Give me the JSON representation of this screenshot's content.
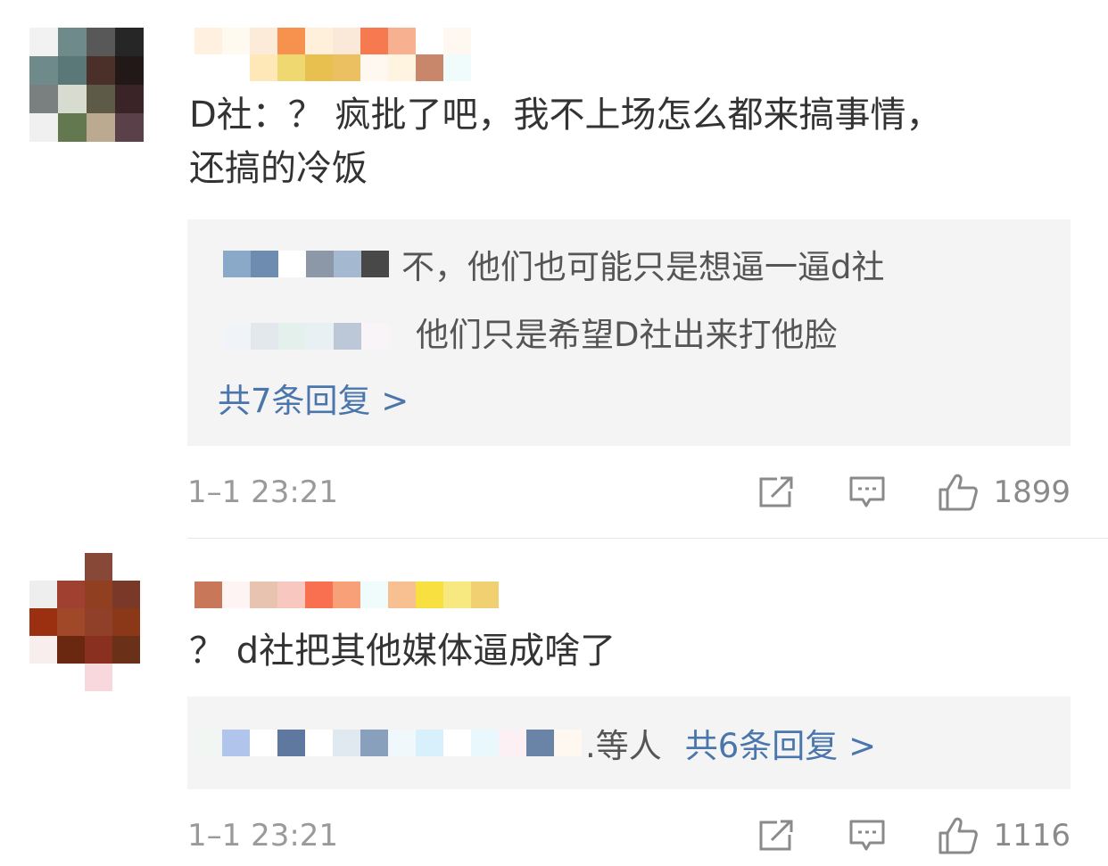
{
  "comments": [
    {
      "text_line1": "D社：？ 疯批了吧，我不上场怎么都来搞事情，",
      "text_line2": "还搞的冷饭",
      "replies": [
        {
          "text": "不，他们也可能只是想逼一逼d社"
        },
        {
          "text": "他们只是希望D社出来打他脸"
        }
      ],
      "more_replies": "共7条回复 >",
      "time": "1–1 23:21",
      "likes": "1899",
      "avatar_colors": [
        "#f2f2f2",
        "#6e8a8a",
        "#585858",
        "#262626",
        "#6e8a8a",
        "#5a7878",
        "#4a3028",
        "#221818",
        "#7a7f80",
        "#d8dcd0",
        "#5e5a48",
        "#3a2428",
        "#f0f0f0",
        "#647850",
        "#bcaa90",
        "#5a4048"
      ],
      "nick_colors": [
        "#fff0e0",
        "#fffaf0",
        "#fcebd8",
        "#f7924e",
        "#fff0dc",
        "#fae8d8",
        "#f77950",
        "#f7b090",
        "#ffffff",
        "#fff8f0",
        "#ffffff",
        "#ffffff",
        "#ffe8b8",
        "#f0d870",
        "#e8c050",
        "#eac060"
      ],
      "nick_colors2": [
        "#fff8f0",
        "#fff4e0",
        "#c8866a",
        "#f0fcfc",
        "#eba070",
        "#fff8f8",
        "#ffffff",
        "#ea9870",
        "#fff7e0",
        "#f0c000",
        "#ffc000",
        "#ffaa00"
      ]
    },
    {
      "text_line1": "？ d社把其他媒体逼成啥了",
      "replies_summary": ".等人",
      "more_replies": "共6条回复 >",
      "time": "1–1 23:21",
      "likes": "1116",
      "avatar_colors": [
        "#ffffff",
        "#ffffff",
        "#884838",
        "#ffffff",
        "#eeeeee",
        "#a04030",
        "#904020",
        "#7a3828",
        "#9a3010",
        "#a04828",
        "#904028",
        "#8a3818",
        "#f8eeee",
        "#6a2810",
        "#8a3020",
        "#6a3018",
        "#ffffff",
        "#ffffff",
        "#f8d8dc",
        "#ffffff"
      ],
      "nick_colors": [
        "#c87858",
        "#fff4f4",
        "#e8c4b0",
        "#f8c8c0",
        "#f87050",
        "#f8a078",
        "#f0fcfc",
        "#f8c090",
        "#f8e040",
        "#f8e880",
        "#f0d070",
        "#ffffff"
      ]
    }
  ],
  "reply_blur_1": [
    "#8aa8c8",
    "#6e8cb0",
    "#ffffff",
    "#8c98a8",
    "#a4b8d0",
    "#484848"
  ],
  "reply_blur_2": [
    "#f0f4f8",
    "#e2e8ec",
    "#e4f0ec",
    "#e8f0f4",
    "#bcc8d8",
    "#f8f4f8"
  ],
  "reply_blur_3": [
    "#f2f6f2",
    "#b0c4ec",
    "#ffffff",
    "#5e78a0",
    "#ffffff",
    "#e0e8f0",
    "#88a0bc",
    "#f0f8fc",
    "#d8f0fc",
    "#ffffff",
    "#e8f8fc",
    "#fcf0f4",
    "#6a84a8",
    "#fff8f0"
  ]
}
